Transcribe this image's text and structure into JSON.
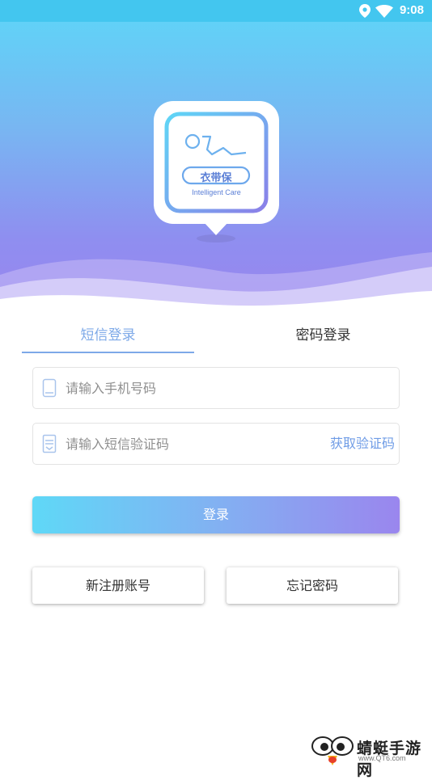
{
  "status_bar": {
    "time": "9:08"
  },
  "logo": {
    "name": "衣带保",
    "tagline": "Intelligent Care"
  },
  "tabs": [
    {
      "label": "短信登录",
      "active": true
    },
    {
      "label": "密码登录",
      "active": false
    }
  ],
  "form": {
    "phone_placeholder": "请输入手机号码",
    "code_placeholder": "请输入短信验证码",
    "get_code_label": "获取验证码",
    "login_label": "登录"
  },
  "actions": {
    "register_label": "新注册账号",
    "forgot_label": "忘记密码"
  },
  "watermark": {
    "text": "蜻蜓手游网",
    "url": "www.QT6.com"
  },
  "colors": {
    "accent": "#7da9e8",
    "gradient_start": "#5dd7f8",
    "gradient_end": "#9b84ee"
  }
}
